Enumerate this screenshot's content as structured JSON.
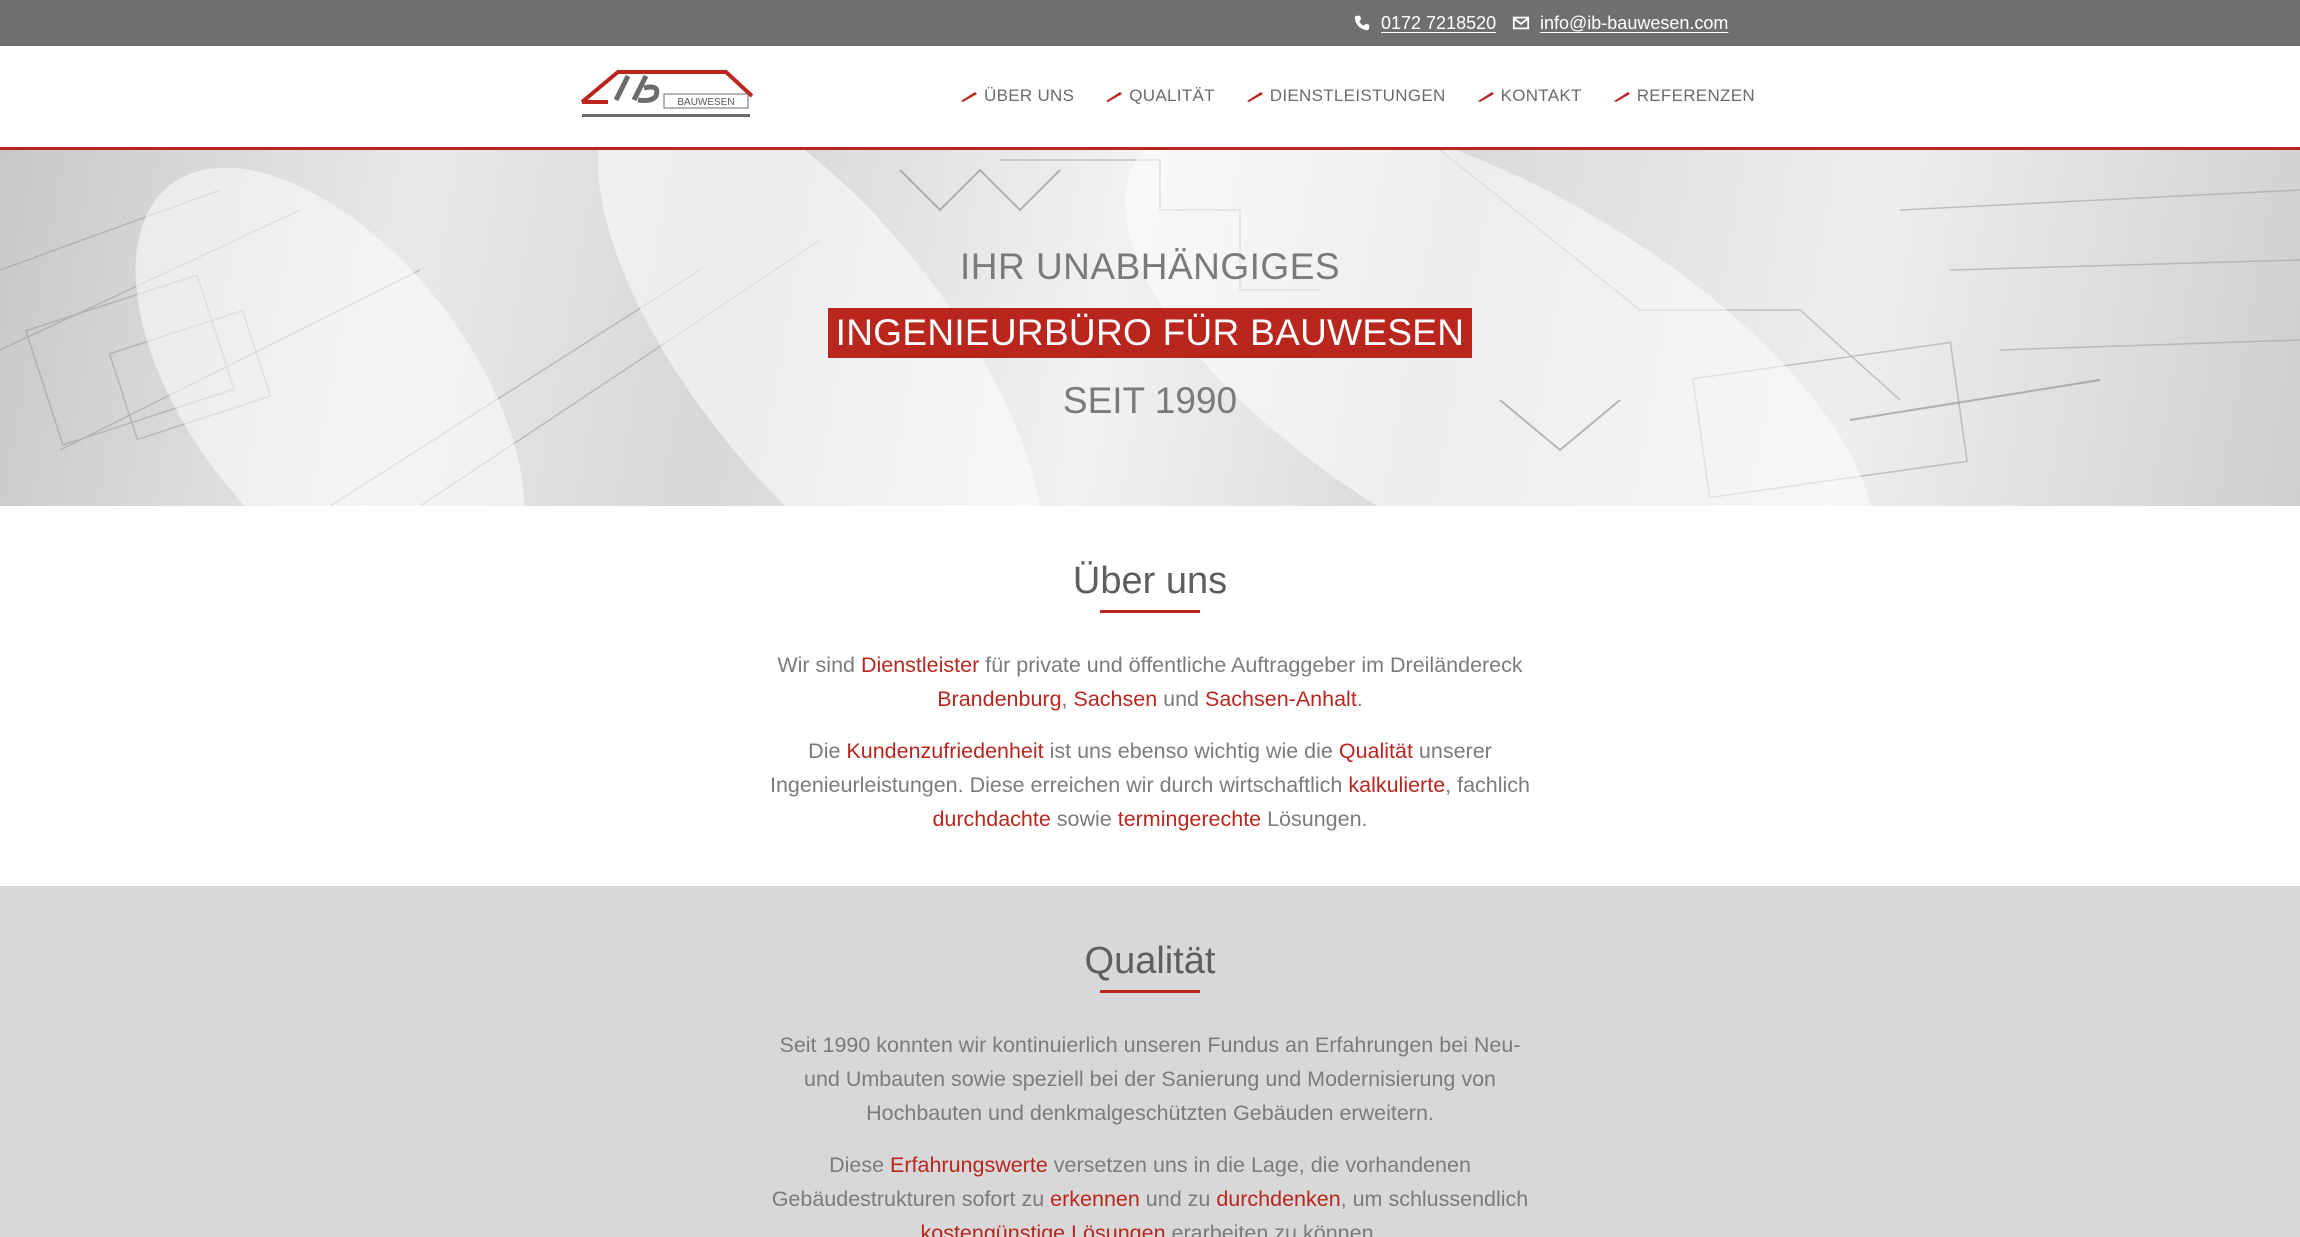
{
  "topbar": {
    "phone": "0172 7218520",
    "email": "info@ib-bauwesen.com"
  },
  "logo": {
    "text": "BAUWESEN"
  },
  "nav": {
    "items": [
      {
        "label": "ÜBER UNS"
      },
      {
        "label": "QUALITÄT"
      },
      {
        "label": "DIENSTLEISTUNGEN"
      },
      {
        "label": "KONTAKT"
      },
      {
        "label": "REFERENZEN"
      }
    ]
  },
  "hero": {
    "line1": "IHR UNABHÄNGIGES",
    "line2": "INGENIEURBÜRO FÜR BAUWESEN",
    "line3": "SEIT 1990"
  },
  "about": {
    "title": "Über uns",
    "p1": {
      "a": "Wir sind ",
      "b": "Dienstleister",
      "c": " für private und öffentliche Auftraggeber im Dreiländereck",
      "d": "Brandenburg",
      "e": ", ",
      "f": "Sachsen",
      "g": " und ",
      "h": "Sachsen-Anhalt",
      "i": "."
    },
    "p2": {
      "a": "Die ",
      "b": "Kundenzufriedenheit",
      "c": " ist uns ebenso wichtig wie die ",
      "d": "Qualität",
      "e": " unserer",
      "f": "Ingenieurleistungen. Diese erreichen wir durch wirtschaftlich ",
      "g": "kalkulierte",
      "h": ", fachlich",
      "i": "durchdachte",
      "j": " sowie ",
      "k": "termingerechte",
      "l": " Lösungen."
    }
  },
  "quality": {
    "title": "Qualität",
    "p1": {
      "line1": "Seit 1990 konnten wir kontinuierlich unseren Fundus an Erfahrungen bei Neu-",
      "line2": "und Umbauten sowie speziell bei der Sanierung und Modernisierung von",
      "line3": "Hochbauten und denkmalgeschützten Gebäuden erweitern."
    },
    "p2": {
      "a": "Diese ",
      "b": "Erfahrungswerte",
      "c": " versetzen uns in die Lage, die vorhandenen",
      "d": "Gebäudestrukturen sofort zu ",
      "e": "erkennen",
      "f": " und zu ",
      "g": "durchdenken",
      "h": ", um schlussendlich",
      "i": "kostengünstige Lösungen",
      "j": " erarbeiten zu können."
    }
  },
  "colors": {
    "accent": "#b8261e",
    "topbar": "#6f6f6f",
    "quality_bg": "#d8d8d8"
  }
}
